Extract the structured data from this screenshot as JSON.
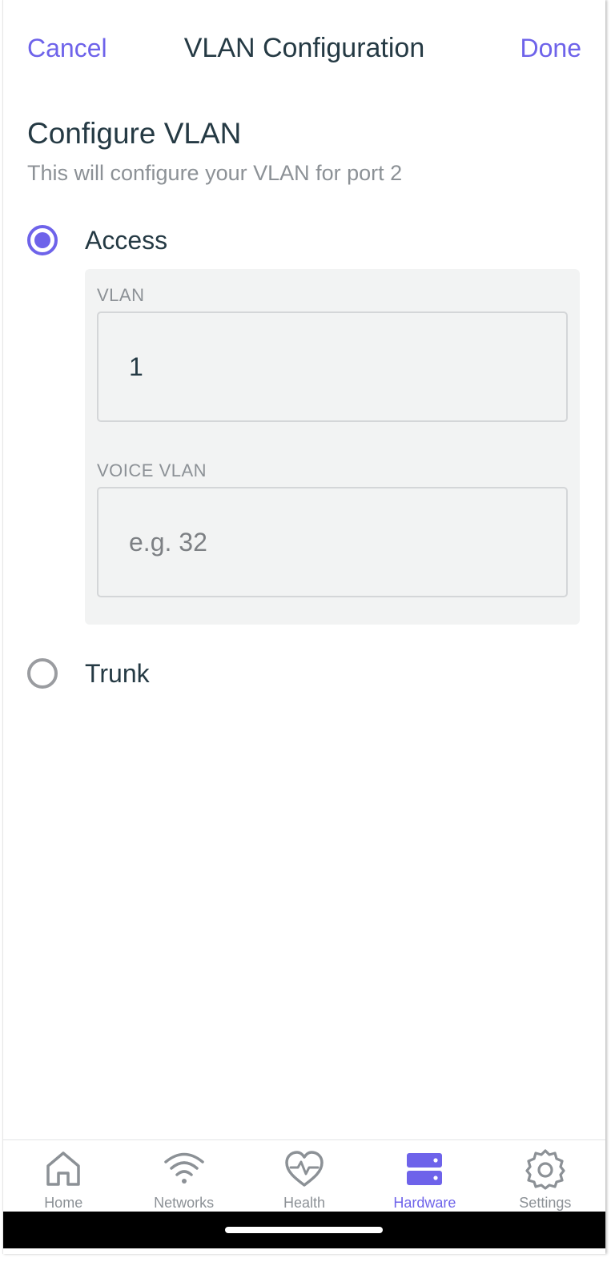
{
  "header": {
    "cancel_label": "Cancel",
    "title": "VLAN Configuration",
    "done_label": "Done"
  },
  "section": {
    "title": "Configure VLAN",
    "subtitle": "This will configure your VLAN for port 2"
  },
  "options": {
    "access": {
      "label": "Access",
      "selected": true
    },
    "trunk": {
      "label": "Trunk",
      "selected": false
    }
  },
  "access_panel": {
    "vlan_label": "VLAN",
    "vlan_value": "1",
    "voice_vlan_label": "VOICE VLAN",
    "voice_vlan_value": "",
    "voice_vlan_placeholder": "e.g. 32"
  },
  "tabs": [
    {
      "label": "Home",
      "icon": "home-icon",
      "active": false
    },
    {
      "label": "Networks",
      "icon": "wifi-icon",
      "active": false
    },
    {
      "label": "Health",
      "icon": "heart-pulse-icon",
      "active": false
    },
    {
      "label": "Hardware",
      "icon": "server-icon",
      "active": true
    },
    {
      "label": "Settings",
      "icon": "gear-icon",
      "active": false
    }
  ],
  "colors": {
    "accent": "#6e63ea",
    "text": "#253a44",
    "muted": "#8c9196",
    "panel": "#f2f3f3"
  }
}
